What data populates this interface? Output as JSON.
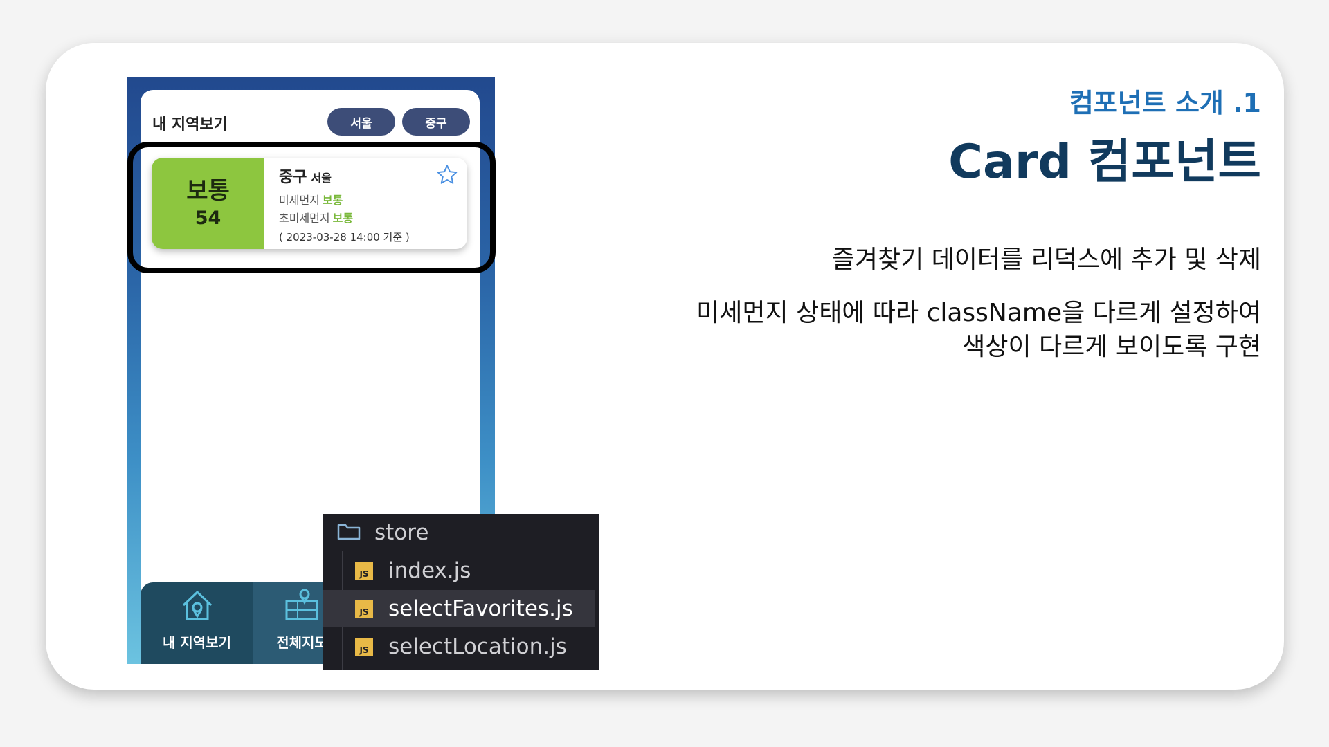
{
  "slide": {
    "subtitle": "컴포넌트 소개 .1",
    "title": "Card 컴포넌트",
    "description_1": "즐겨찾기 데이터를 리덕스에 추가 및 삭제",
    "description_2_line1": "미세먼지 상태에 따라 className을 다르게 설정하여",
    "description_2_line2": "색상이 다르게 보이도록 구현"
  },
  "app": {
    "header_title": "내 지역보기",
    "sido_select": "서울",
    "station_select": "중구",
    "card": {
      "grade": "보통",
      "value": "54",
      "station": "중구",
      "sido": "서울",
      "pm10_label": "미세먼지",
      "pm10_grade": "보통",
      "pm25_label": "초미세먼지",
      "pm25_grade": "보통",
      "timestamp": "( 2023-03-28 14:00 기준 )",
      "grade_color": "#8dc63f"
    },
    "nav": {
      "mine_label": "내 지역보기",
      "all_label": "전체지도"
    }
  },
  "file_tree": {
    "folder": "store",
    "files": [
      "index.js",
      "selectFavorites.js",
      "selectLocation.js"
    ],
    "badge": "JS",
    "selected_index": 1
  },
  "colors": {
    "subtitle": "#1e6fb5",
    "title": "#113a5d",
    "accent_green": "#79b83a",
    "pill": "#3d4d78"
  }
}
